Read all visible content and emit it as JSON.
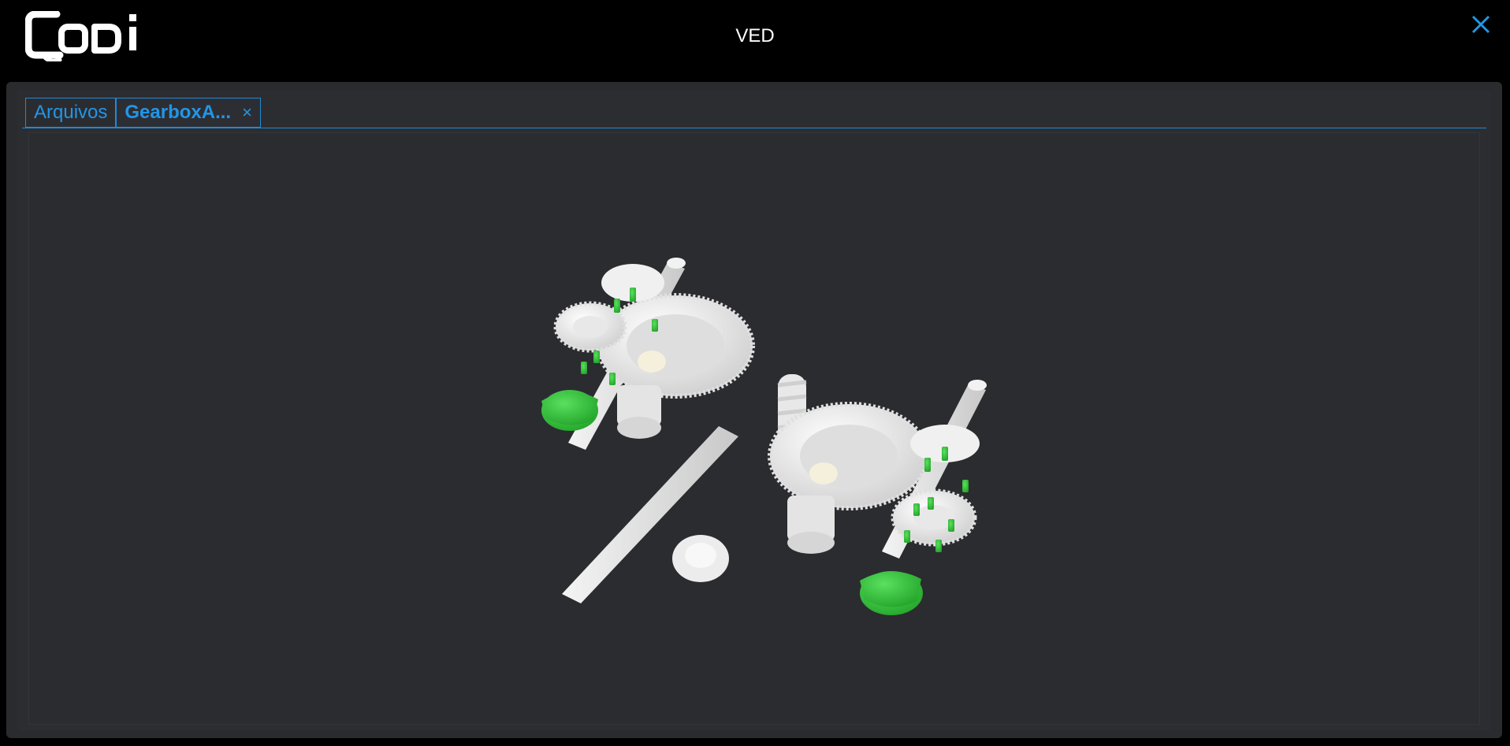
{
  "header": {
    "logo_text": "Codi",
    "title": "VED",
    "close_icon": "close-icon"
  },
  "tabs": [
    {
      "label": "Arquivos",
      "active": false
    },
    {
      "label": "GearboxA...",
      "active": true,
      "close_icon": "close-icon",
      "close_label": "×"
    }
  ],
  "viewer": {
    "model_name": "gearbox-3d-model",
    "colors": {
      "background": "#2b2c30",
      "part": "#e8e8e8",
      "highlight": "#33c63a",
      "accent": "#2196e8"
    }
  }
}
